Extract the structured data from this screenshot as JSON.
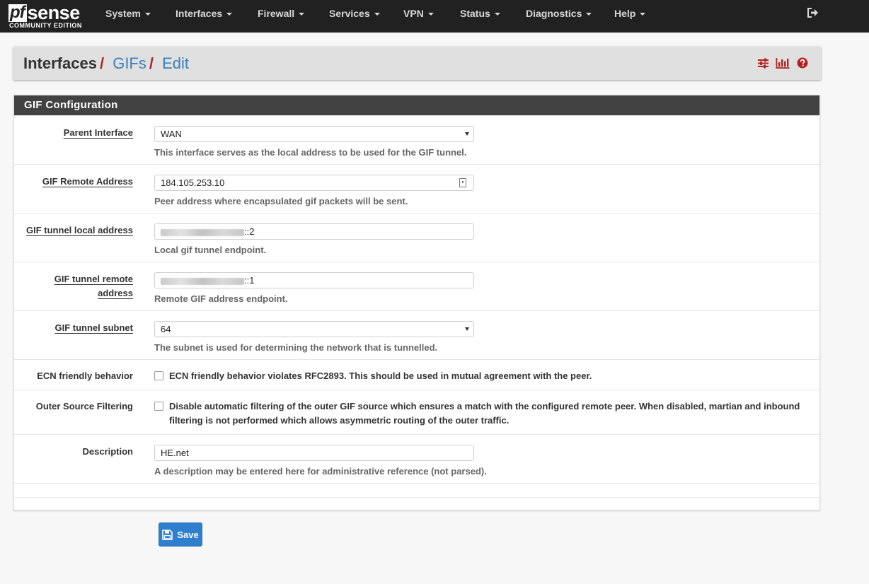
{
  "brand": {
    "logo_pf": "pf",
    "logo_sense": "sense",
    "edition": "COMMUNITY EDITION"
  },
  "nav": [
    {
      "label": "System"
    },
    {
      "label": "Interfaces"
    },
    {
      "label": "Firewall"
    },
    {
      "label": "Services"
    },
    {
      "label": "VPN"
    },
    {
      "label": "Status"
    },
    {
      "label": "Diagnostics"
    },
    {
      "label": "Help"
    }
  ],
  "breadcrumb": {
    "root": "Interfaces",
    "sep": "/",
    "section": "GIFs",
    "page": "Edit"
  },
  "panel": {
    "title": "GIF Configuration",
    "fields": {
      "parent_interface": {
        "label": "Parent Interface",
        "value": "WAN",
        "help": "This interface serves as the local address to be used for the GIF tunnel."
      },
      "remote_address": {
        "label": "GIF Remote Address",
        "value": "184.105.253.10",
        "help": "Peer address where encapsulated gif packets will be sent."
      },
      "tunnel_local": {
        "label": "GIF tunnel local address",
        "value_suffix": "::2",
        "help": "Local gif tunnel endpoint."
      },
      "tunnel_remote": {
        "label_line1": "GIF tunnel remote",
        "label_line2": "address",
        "value_suffix": "::1",
        "help": "Remote GIF address endpoint."
      },
      "tunnel_subnet": {
        "label": "GIF tunnel subnet",
        "value": "64",
        "help": "The subnet is used for determining the network that is tunnelled."
      },
      "ecn": {
        "label": "ECN friendly behavior",
        "text": "ECN friendly behavior violates RFC2893. This should be used in mutual agreement with the peer.",
        "checked": false
      },
      "outer_source": {
        "label": "Outer Source Filtering",
        "text": "Disable automatic filtering of the outer GIF source which ensures a match with the configured remote peer. When disabled, martian and inbound filtering is not performed which allows asymmetric routing of the outer traffic.",
        "checked": false
      },
      "description": {
        "label": "Description",
        "value": "HE.net",
        "help": "A description may be entered here for administrative reference (not parsed)."
      }
    }
  },
  "save_label": "Save",
  "colors": {
    "navbar": "#212121",
    "accent_red": "#a52a2a",
    "link_blue": "#3c7fb8",
    "button_blue": "#2f7fcf",
    "icon_red": "#b22222"
  },
  "icons": {
    "logout": "sign-out-icon",
    "settings": "sliders-icon",
    "chart": "bar-chart-icon",
    "help": "question-circle-icon",
    "save": "floppy-disk-icon"
  }
}
